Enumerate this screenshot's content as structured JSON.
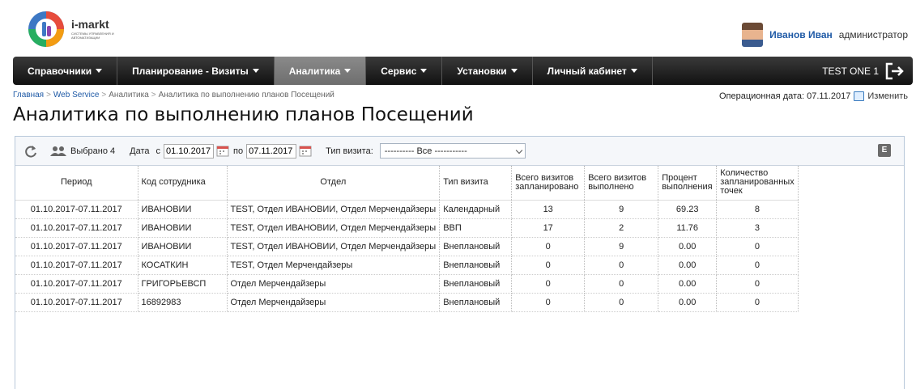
{
  "brand": {
    "name": "i-markt",
    "tagline": "СИСТЕМЫ УПРАВЛЕНИЯ И АВТОМАТИЗАЦИИ"
  },
  "user": {
    "name": "Иванов Иван",
    "role": "администратор"
  },
  "nav": {
    "items": [
      {
        "label": "Справочники"
      },
      {
        "label": "Планирование - Визиты"
      },
      {
        "label": "Аналитика"
      },
      {
        "label": "Сервис"
      },
      {
        "label": "Установки"
      },
      {
        "label": "Личный кабинет"
      }
    ],
    "account": "TEST ONE 1"
  },
  "breadcrumb": {
    "home": "Главная",
    "section": "Web Service",
    "analytics": "Аналитика",
    "current": "Аналитика по выполнению планов Посещений"
  },
  "op_date": {
    "label": "Операционная дата: 07.11.2017",
    "change": "Изменить"
  },
  "page_title": "Аналитика по выполнению планов Посещений",
  "toolbar": {
    "selected": "Выбрано 4",
    "date_label": "Дата",
    "from_label": "с",
    "from": "01.10.2017",
    "to_label": "по",
    "to": "07.11.2017",
    "visit_type_label": "Тип визита:",
    "visit_type_value": "---------- Все -----------",
    "excel": "E"
  },
  "table": {
    "headers": [
      "Период",
      "Код сотрудника",
      "Отдел",
      "Тип визита",
      "Всего визитов запланировано",
      "Всего визитов выполнено",
      "Процент выполнения",
      "Количество запланированных точек"
    ],
    "rows": [
      [
        "01.10.2017-07.11.2017",
        "ИВАНОВИИ",
        "TEST, Отдел ИВАНОВИИ, Отдел Мерчендайзеры",
        "Календарный",
        "13",
        "9",
        "69.23",
        "8"
      ],
      [
        "01.10.2017-07.11.2017",
        "ИВАНОВИИ",
        "TEST, Отдел ИВАНОВИИ, Отдел Мерчендайзеры",
        "ВВП",
        "17",
        "2",
        "11.76",
        "3"
      ],
      [
        "01.10.2017-07.11.2017",
        "ИВАНОВИИ",
        "TEST, Отдел ИВАНОВИИ, Отдел Мерчендайзеры",
        "Внеплановый",
        "0",
        "9",
        "0.00",
        "0"
      ],
      [
        "01.10.2017-07.11.2017",
        "КОСАТКИН",
        "TEST, Отдел Мерчендайзеры",
        "Внеплановый",
        "0",
        "0",
        "0.00",
        "0"
      ],
      [
        "01.10.2017-07.11.2017",
        "ГРИГОРЬЕВСП",
        "Отдел Мерчендайзеры",
        "Внеплановый",
        "0",
        "0",
        "0.00",
        "0"
      ],
      [
        "01.10.2017-07.11.2017",
        "16892983",
        "Отдел Мерчендайзеры",
        "Внеплановый",
        "0",
        "0",
        "0.00",
        "0"
      ]
    ]
  }
}
